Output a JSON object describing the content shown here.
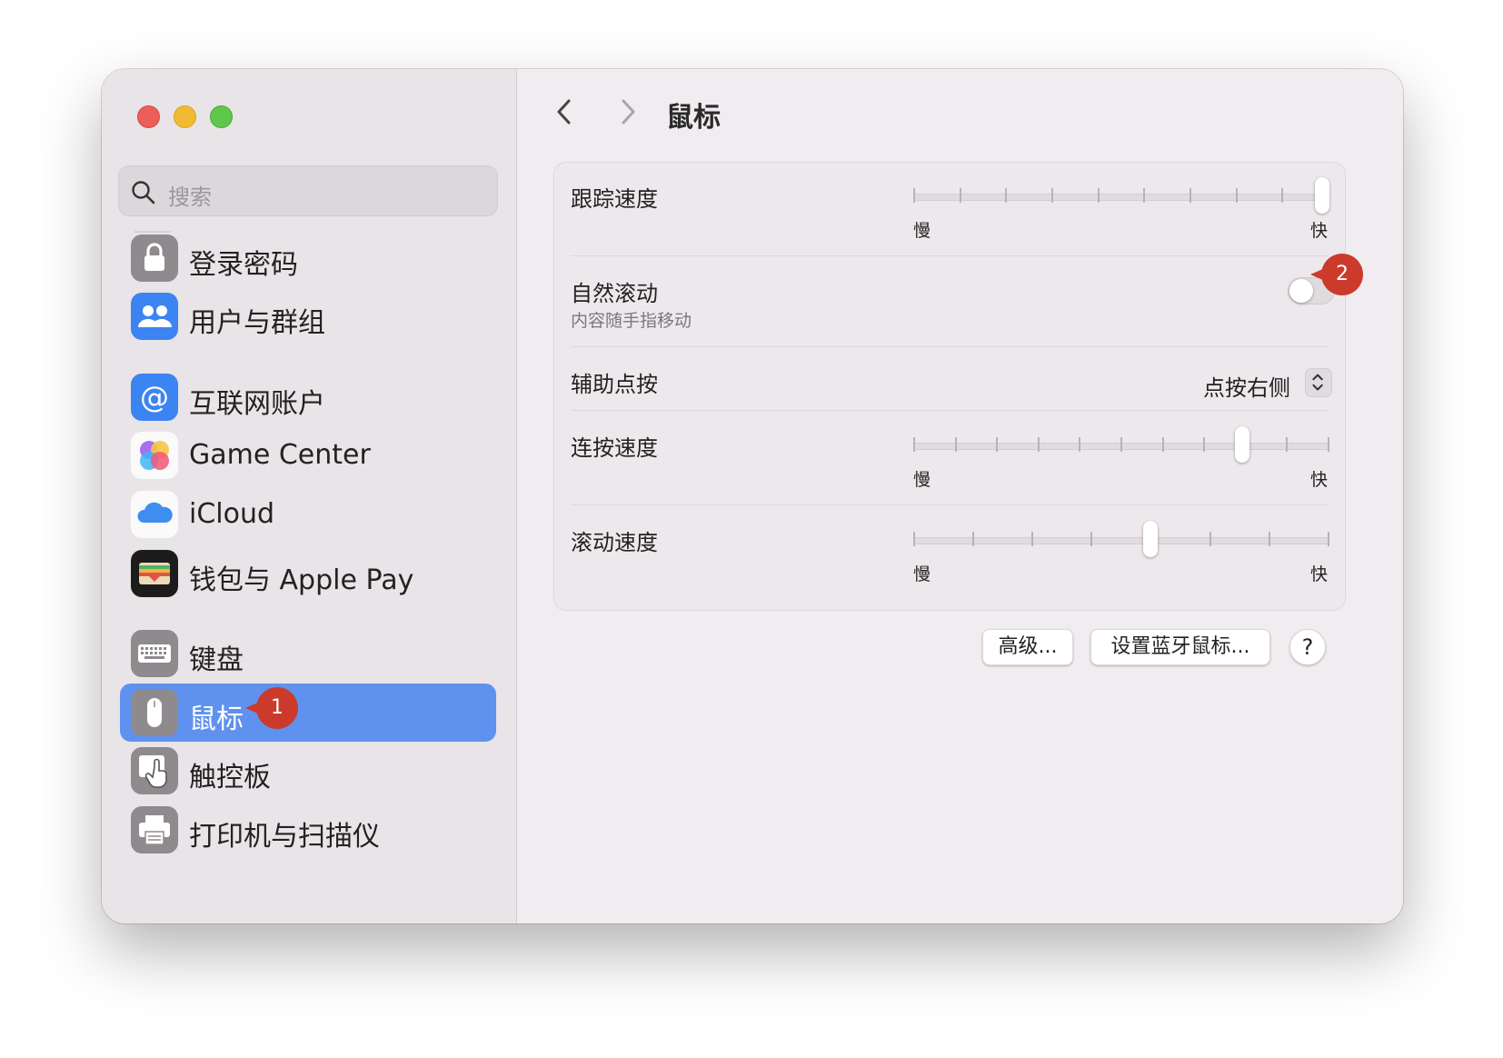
{
  "sidebar": {
    "search_placeholder": "搜索",
    "items": [
      {
        "label": "登录密码",
        "icon": "lock-icon"
      },
      {
        "label": "用户与群组",
        "icon": "users-icon"
      },
      {
        "label": "互联网账户",
        "icon": "at-icon"
      },
      {
        "label": "Game Center",
        "icon": "game-center-icon"
      },
      {
        "label": "iCloud",
        "icon": "icloud-icon"
      },
      {
        "label": "钱包与 Apple Pay",
        "icon": "wallet-icon"
      },
      {
        "label": "键盘",
        "icon": "keyboard-icon"
      },
      {
        "label": "鼠标",
        "icon": "mouse-icon",
        "selected": true
      },
      {
        "label": "触控板",
        "icon": "trackpad-icon"
      },
      {
        "label": "打印机与扫描仪",
        "icon": "printer-icon"
      }
    ],
    "selected_color": "#5f92ee"
  },
  "header": {
    "title": "鼠标"
  },
  "settings": {
    "tracking_speed": {
      "label": "跟踪速度",
      "min_label": "慢",
      "max_label": "快",
      "value_fraction": 1.0
    },
    "natural_scrolling": {
      "label": "自然滚动",
      "description": "内容随手指移动",
      "enabled": false
    },
    "secondary_click": {
      "label": "辅助点按",
      "value": "点按右侧"
    },
    "double_click_speed": {
      "label": "连按速度",
      "min_label": "慢",
      "max_label": "快",
      "value_fraction": 0.79
    },
    "scroll_speed": {
      "label": "滚动速度",
      "min_label": "慢",
      "max_label": "快",
      "value_fraction": 0.57
    }
  },
  "footer": {
    "advanced_label": "高级...",
    "bluetooth_label": "设置蓝牙鼠标...",
    "help_label": "?"
  },
  "annotations": {
    "badge1": "1",
    "badge2": "2",
    "badge_color": "#cc3a2b"
  }
}
